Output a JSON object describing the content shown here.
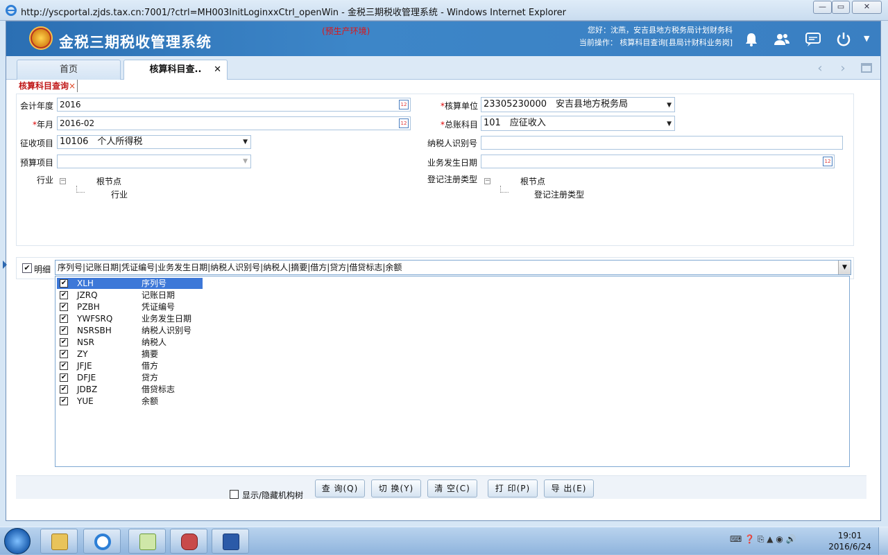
{
  "window": {
    "title": "http://yscportal.zjds.tax.cn:7001/?ctrl=MH003InitLoginxxCtrl_openWin - 金税三期税收管理系统 - Windows Internet Explorer",
    "min": "—",
    "max": "▭",
    "close": "✕"
  },
  "header": {
    "app_title": "金税三期税收管理系统",
    "env_tag": "(预生产环境)",
    "greeting": "您好：沈燕，安吉县地方税务局计划财务科",
    "current_op": "当前操作： 核算科目查询[县局计财科业务岗]",
    "icons": [
      "bell-icon",
      "people-icon",
      "chat-icon",
      "power-icon"
    ],
    "dropdown": "▼"
  },
  "tabs": {
    "home": "首页",
    "query": "核算科目查..",
    "close": "✕",
    "prev": "‹",
    "next": "›"
  },
  "subtab": {
    "label": "核算科目查询",
    "close": "×"
  },
  "form": {
    "fiscal_year_label": "会计年度",
    "fiscal_year_value": "2016",
    "month_label": "年月",
    "month_value": "2016-02",
    "levy_item_label": "征收项目",
    "levy_item_value": "10106　个人所得税",
    "budget_item_label": "预算项目",
    "budget_item_value": "",
    "industry_label": "行业",
    "industry_tree": {
      "root": "根节点",
      "child": "行业"
    },
    "unit_label": "核算单位",
    "unit_value": "23305230000　安吉县地方税务局",
    "ledger_label": "总账科目",
    "ledger_value": "101　应征收入",
    "taxpayer_id_label": "纳税人识别号",
    "taxpayer_id_value": "",
    "biz_date_label": "业务发生日期",
    "biz_date_value": "",
    "reg_type_label": "登记注册类型",
    "reg_type_tree": {
      "root": "根节点",
      "child": "登记注册类型"
    },
    "required_mark": "*",
    "calendar_glyph": "12",
    "tree_toggle": "−"
  },
  "detail": {
    "checked": "✔",
    "label": "明细",
    "columns_value": "序列号|记账日期|凭证编号|业务发生日期|纳税人识别号|纳税人|摘要|借方|贷方|借贷标志|余额",
    "dropdown": "▼"
  },
  "column_options": [
    {
      "code": "XLH",
      "name": "序列号",
      "checked": "✔"
    },
    {
      "code": "JZRQ",
      "name": "记账日期",
      "checked": "✔"
    },
    {
      "code": "PZBH",
      "name": "凭证编号",
      "checked": "✔"
    },
    {
      "code": "YWFSRQ",
      "name": "业务发生日期",
      "checked": "✔"
    },
    {
      "code": "NSRSBH",
      "name": "纳税人识别号",
      "checked": "✔"
    },
    {
      "code": "NSR",
      "name": "纳税人",
      "checked": "✔"
    },
    {
      "code": "ZY",
      "name": "摘要",
      "checked": "✔"
    },
    {
      "code": "JFJE",
      "name": "借方",
      "checked": "✔"
    },
    {
      "code": "DFJE",
      "name": "贷方",
      "checked": "✔"
    },
    {
      "code": "JDBZ",
      "name": "借贷标志",
      "checked": "✔"
    },
    {
      "code": "YUE",
      "name": "余额",
      "checked": "✔"
    }
  ],
  "actions": {
    "show_org_label": "显示/隐藏机构树",
    "query": "查 询(Q)",
    "switch": "切 换(Y)",
    "clear": "清 空(C)",
    "print": "打 印(P)",
    "export": "导 出(E)"
  },
  "taskbar": {
    "tray": "⌨ ❓ ⎘ ▲ ◉ 🔊",
    "time": "19:01",
    "date": "2016/6/24"
  },
  "colors": {
    "header_blue": "#3a7fc2",
    "env_red": "#e01515",
    "subtab_red": "#c01818",
    "selected_option": "#3d78d8"
  }
}
